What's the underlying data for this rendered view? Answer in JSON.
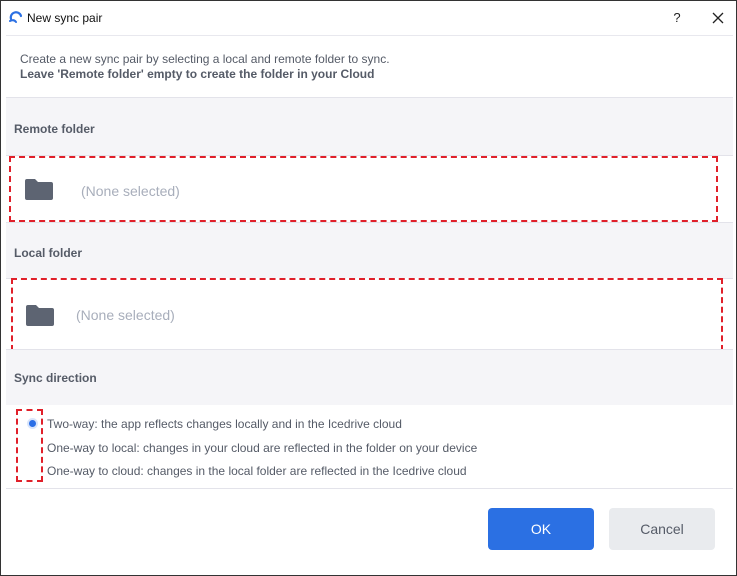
{
  "window": {
    "title": "New sync pair",
    "help_label": "?",
    "icons": {
      "app": "icedrive-logo-icon",
      "close": "close-icon"
    }
  },
  "intro": {
    "line1": "Create a new sync pair by selecting a local and remote folder to sync.",
    "line2": "Leave 'Remote folder' empty to create the folder in your Cloud"
  },
  "remote": {
    "label": "Remote folder",
    "value": "(None selected)",
    "icon": "folder-icon"
  },
  "local": {
    "label": "Local folder",
    "value": "(None selected)",
    "icon": "folder-icon"
  },
  "sync": {
    "label": "Sync direction",
    "options": [
      {
        "label": "Two-way: the app reflects changes locally and in the Icedrive cloud",
        "selected": true
      },
      {
        "label": "One-way to local: changes in your cloud are reflected in the folder on your device",
        "selected": false
      },
      {
        "label": "One-way to cloud: changes in the local folder are reflected in the Icedrive cloud",
        "selected": false
      }
    ]
  },
  "buttons": {
    "ok": "OK",
    "cancel": "Cancel"
  },
  "colors": {
    "accent": "#2b70e3",
    "highlight": "#e0202a",
    "muted_text": "#a8aebb",
    "label_text": "#555b67"
  }
}
